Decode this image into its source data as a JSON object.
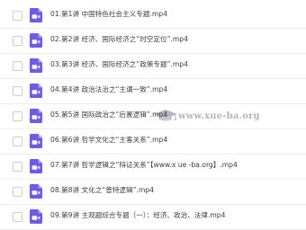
{
  "files": [
    {
      "name": "01.第1讲 中国特色社会主义专题.mp4"
    },
    {
      "name": "02.第2讲 经济、国际经济之“时空定位”.mp4"
    },
    {
      "name": "03.第3讲 经济、国际经济之“政策专题”.mp4"
    },
    {
      "name": "04.第4讲 政治法治之“主谓一致”.mp4"
    },
    {
      "name": "05.第5讲 国际政治之“后置逻辑”.mp4"
    },
    {
      "name": "06.第6讲 哲学文化之“主客关系”.mp4"
    },
    {
      "name": "07.第7讲 哲学逻辑之“辩证关系”【www.x ue -ba.org】.mp4"
    },
    {
      "name": "08.第8讲 文化之“普特逻辑”.mp4"
    },
    {
      "name": "09.第9讲 主观题综合专题（一）：经济、政治、法律.mp4"
    }
  ],
  "watermark": {
    "text": "www.xue-ba.org"
  },
  "icons": {
    "file_icon": "video-file-icon",
    "watermark_icon": "graduation-cap-icon"
  },
  "colors": {
    "file_icon": "#6c5ce7",
    "text": "#3a3d44",
    "divider": "#eceef2",
    "checkbox_border": "#c9ccd3"
  }
}
